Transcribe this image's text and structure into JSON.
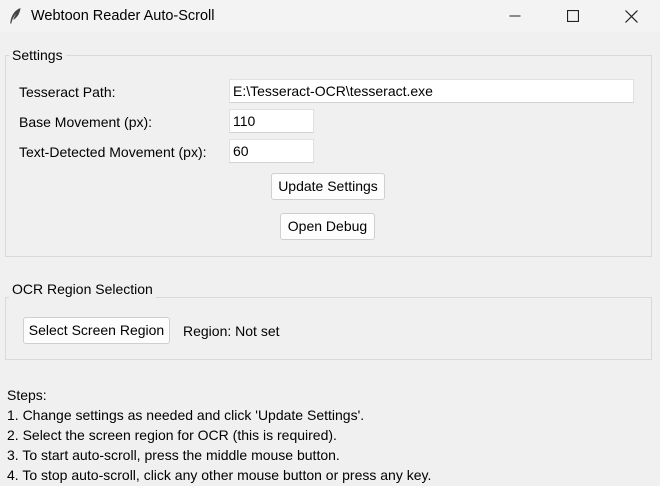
{
  "window": {
    "title": "Webtoon Reader Auto-Scroll",
    "icon": "feather-icon"
  },
  "settings": {
    "legend": "Settings",
    "tesseract_label": "Tesseract Path:",
    "tesseract_value": "E:\\Tesseract-OCR\\tesseract.exe",
    "base_label": "Base Movement (px):",
    "base_value": "110",
    "text_label": "Text-Detected Movement (px):",
    "text_value": "60",
    "update_button": "Update Settings",
    "debug_button": "Open Debug"
  },
  "ocr": {
    "legend": "OCR Region Selection",
    "select_button": "Select Screen Region",
    "region_status": "Region: Not set"
  },
  "steps": {
    "heading": "Steps:",
    "items": [
      "1. Change settings as needed and click 'Update Settings'.",
      "2. Select the screen region for OCR (this is required).",
      "3. To start auto-scroll, press the middle mouse button.",
      "4. To stop auto-scroll, click any other mouse button or press any key."
    ]
  }
}
